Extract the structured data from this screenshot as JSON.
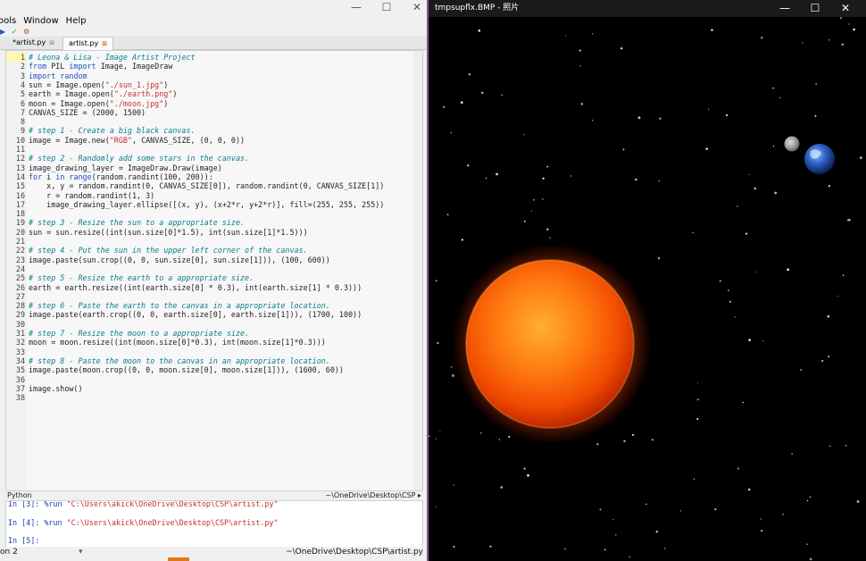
{
  "ide": {
    "menu": [
      "ools",
      "Window",
      "Help"
    ],
    "window_controls": [
      "—",
      "☐",
      "✕"
    ],
    "toolbar_glyphs": [
      "▶",
      "✓",
      "⚙"
    ],
    "tabs": [
      {
        "label": "*artist.py",
        "close": "⊠"
      },
      {
        "label": "artist.py",
        "close": "⊠"
      }
    ],
    "code_lines": [
      "# Leona & Lisa - Image Artist Project",
      "from PIL import Image, ImageDraw",
      "import random",
      "sun = Image.open(\"./sun_1.jpg\")",
      "earth = Image.open(\"./earth.png\")",
      "moon = Image.open(\"./moon.jpg\")",
      "CANVAS_SIZE = (2000, 1500)",
      "",
      "# step 1 - Create a big black canvas.",
      "image = Image.new(\"RGB\", CANVAS_SIZE, (0, 0, 0))",
      "",
      "# step 2 - Randomly add some stars in the canvas.",
      "image_drawing_layer = ImageDraw.Draw(image)",
      "for i in range(random.randint(100, 200)):",
      "    x, y = random.randint(0, CANVAS_SIZE[0]), random.randint(0, CANVAS_SIZE[1])",
      "    r = random.randint(1, 3)",
      "    image_drawing_layer.ellipse([(x, y), (x+2*r, y+2*r)], fill=(255, 255, 255))",
      "",
      "# step 3 - Resize the sun to a appropriate size.",
      "sun = sun.resize((int(sun.size[0]*1.5), int(sun.size[1]*1.5)))",
      "",
      "# step 4 - Put the sun in the upper left corner of the canvas.",
      "image.paste(sun.crop((0, 0, sun.size[0], sun.size[1])), (100, 600))",
      "",
      "# step 5 - Resize the earth to a appropriate size.",
      "earth = earth.resize((int(earth.size[0] * 0.3), int(earth.size[1] * 0.3)))",
      "",
      "# step 6 - Paste the earth to the canvas in a appropriate location.",
      "image.paste(earth.crop((0, 0, earth.size[0], earth.size[1])), (1700, 100))",
      "",
      "# step 7 - Resize the moon to a appropriate size.",
      "moon = moon.resize((int(moon.size[0]*0.3), int(moon.size[1]*0.3)))",
      "",
      "# step 8 - Paste the moon to the canvas in an appropriate location.",
      "image.paste(moon.crop((0, 0, moon.size[0], moon.size[1])), (1600, 60))",
      "",
      "image.show()",
      ""
    ],
    "current_line": 1,
    "status_language": "Python",
    "status_path": "~\\OneDrive\\Desktop\\CSP ▸",
    "console_lines": [
      {
        "prompt": "In [3]: ",
        "cmd": "%run ",
        "arg": "\"C:\\Users\\akick\\OneDrive\\Desktop\\CSP\\artist.py\""
      },
      {
        "prompt": "",
        "cmd": "",
        "arg": ""
      },
      {
        "prompt": "In [4]: ",
        "cmd": "%run ",
        "arg": "\"C:\\Users\\akick\\OneDrive\\Desktop\\CSP\\artist.py\""
      },
      {
        "prompt": "",
        "cmd": "",
        "arg": ""
      },
      {
        "prompt": "In [5]:",
        "cmd": "",
        "arg": ""
      }
    ],
    "bottom_status": {
      "left": "on 2",
      "middle": "▾",
      "right": "~\\OneDrive\\Desktop\\CSP\\artist.py"
    }
  },
  "photos": {
    "title": "tmpsupflx.BMP - 照片",
    "window_controls": [
      "—",
      "☐",
      "✕"
    ],
    "colors": {
      "background": "#000000",
      "sun": "#ff6a00",
      "earth": "#2a5fc0",
      "moon": "#9a9a9a",
      "star": "#ffffff"
    }
  }
}
